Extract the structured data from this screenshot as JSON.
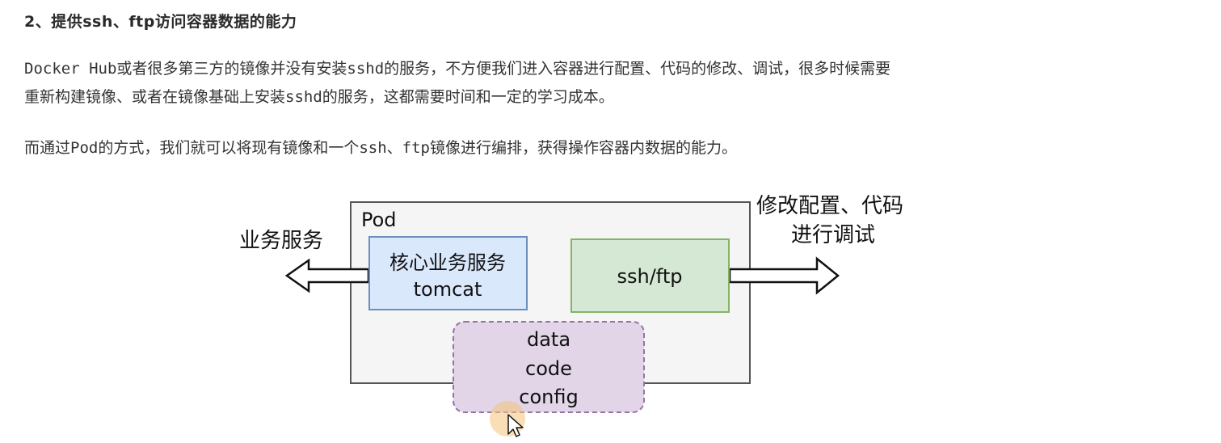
{
  "section": {
    "heading": "2、提供ssh、ftp访问容器数据的能力",
    "paragraph1_line1": "Docker Hub或者很多第三方的镜像并没有安装sshd的服务，不方便我们进入容器进行配置、代码的修改、调试，很多时候需要",
    "paragraph1_line2": "重新构建镜像、或者在镜像基础上安装sshd的服务，这都需要时间和一定的学习成本。",
    "paragraph2": "而通过Pod的方式，我们就可以将现有镜像和一个ssh、ftp镜像进行编排，获得操作容器内数据的能力。"
  },
  "diagram": {
    "pod_label": "Pod",
    "left_arrow_label": "业务服务",
    "right_arrow_label_line1": "修改配置、代码",
    "right_arrow_label_line2": "进行调试",
    "core_box_line1": "核心业务服务",
    "core_box_line2": "tomcat",
    "ssh_box_label": "ssh/ftp",
    "data_box_line1": "data",
    "data_box_line2": "code",
    "data_box_line3": "config",
    "colors": {
      "pod_fill": "#f5f5f5",
      "pod_stroke": "#555555",
      "core_fill": "#dae8fc",
      "core_stroke": "#6c8ebf",
      "ssh_fill": "#d5e8d4",
      "ssh_stroke": "#82b366",
      "data_fill": "#e1d5e7",
      "data_stroke": "#9673a6",
      "cursor_highlight": "#f6c27a"
    }
  }
}
